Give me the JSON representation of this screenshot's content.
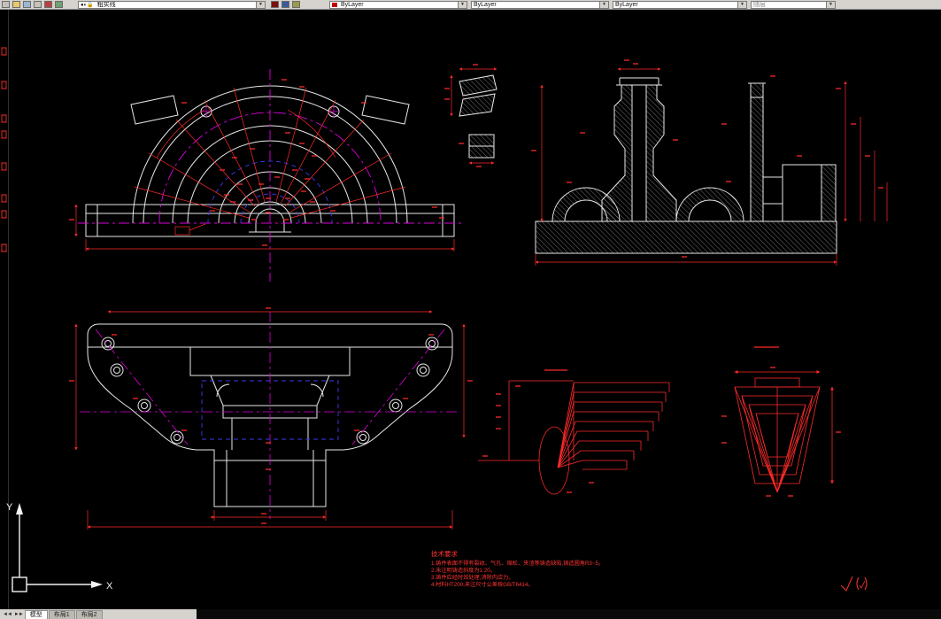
{
  "toolbar": {
    "layer_value": "粗实线",
    "color_value": "ByLayer",
    "linetype_value": "ByLayer",
    "lineweight_value": "ByLayer",
    "plotstyle_value": "随层"
  },
  "tab_bar": {
    "nav_back": "◄◄",
    "nav_fwd": "►►",
    "tabs": [
      "模型",
      "布局1",
      "布局2"
    ]
  },
  "ucs": {
    "x": "X",
    "y": "Y"
  },
  "notes": {
    "title": "技术要求",
    "lines": [
      "1.铸件表面不得有裂纹、气孔、缩松、夹渣等铸造缺陷,铸造圆角R3~5。",
      "2.未注明铸造斜度为1:20。",
      "3.铸件应经时效处理,消除内应力。",
      "4.材料HT200,未注尺寸公差按GB/T6414。"
    ]
  },
  "colors": {
    "dimension_red": "#ff2a2a",
    "geometry_white": "#e8e8e8",
    "centerline_magenta": "#dd00dd",
    "hidden_blue": "#3a3aee"
  }
}
